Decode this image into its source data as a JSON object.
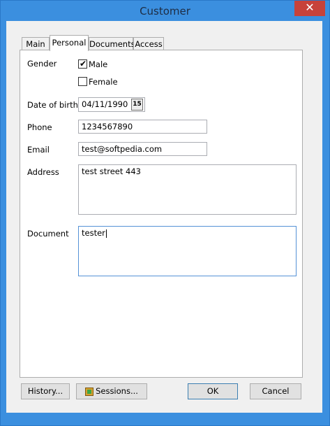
{
  "window": {
    "title": "Customer",
    "close_glyph": "✕"
  },
  "tabs": [
    {
      "label": "Main",
      "active": false
    },
    {
      "label": "Personal",
      "active": true
    },
    {
      "label": "Documents",
      "active": false
    },
    {
      "label": "Access",
      "active": false
    }
  ],
  "personal": {
    "gender_label": "Gender",
    "male_label": "Male",
    "male_checked": true,
    "female_label": "Female",
    "female_checked": false,
    "dob_label": "Date of birth",
    "dob_value": "04/11/1990",
    "calendar_glyph": "15",
    "phone_label": "Phone",
    "phone_value": "1234567890",
    "email_label": "Email",
    "email_value": "test@softpedia.com",
    "address_label": "Address",
    "address_value": "test street 443",
    "document_label": "Document",
    "document_value": "tester"
  },
  "buttons": {
    "history": "History...",
    "sessions": "Sessions...",
    "ok": "OK",
    "cancel": "Cancel"
  }
}
